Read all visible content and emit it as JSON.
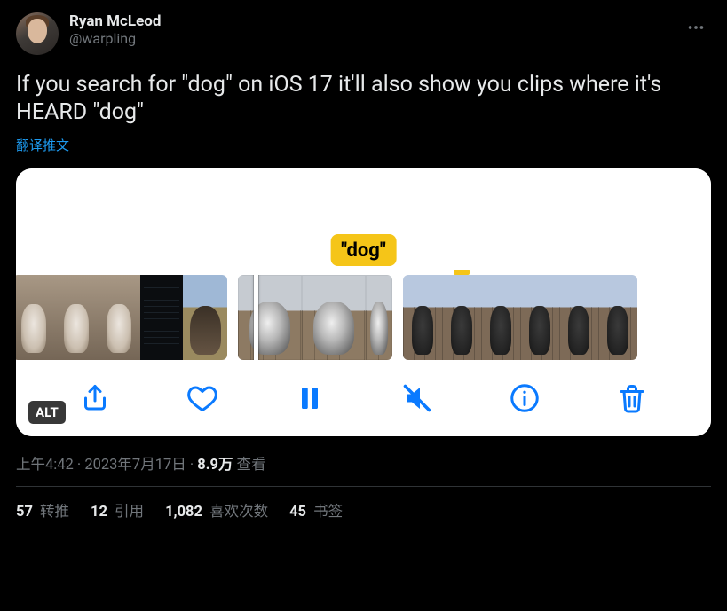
{
  "tweet": {
    "author": {
      "display_name": "Ryan McLeod",
      "handle": "@warpling"
    },
    "text": "If you search for \"dog\" on iOS 17 it'll also show you clips where it's HEARD \"dog\"",
    "translate_label": "翻译推文",
    "media": {
      "caption_label": "\"dog\"",
      "alt_badge": "ALT"
    },
    "meta": {
      "time": "上午4:42",
      "dot1": " · ",
      "date": "2023年7月17日",
      "dot2": " · ",
      "views_number": "8.9万",
      "views_label": " 查看"
    },
    "stats": {
      "retweets": {
        "count": "57",
        "label": " 转推"
      },
      "quotes": {
        "count": "12",
        "label": " 引用"
      },
      "likes": {
        "count": "1,082",
        "label": " 喜欢次数"
      },
      "bookmarks": {
        "count": "45",
        "label": " 书签"
      }
    }
  }
}
